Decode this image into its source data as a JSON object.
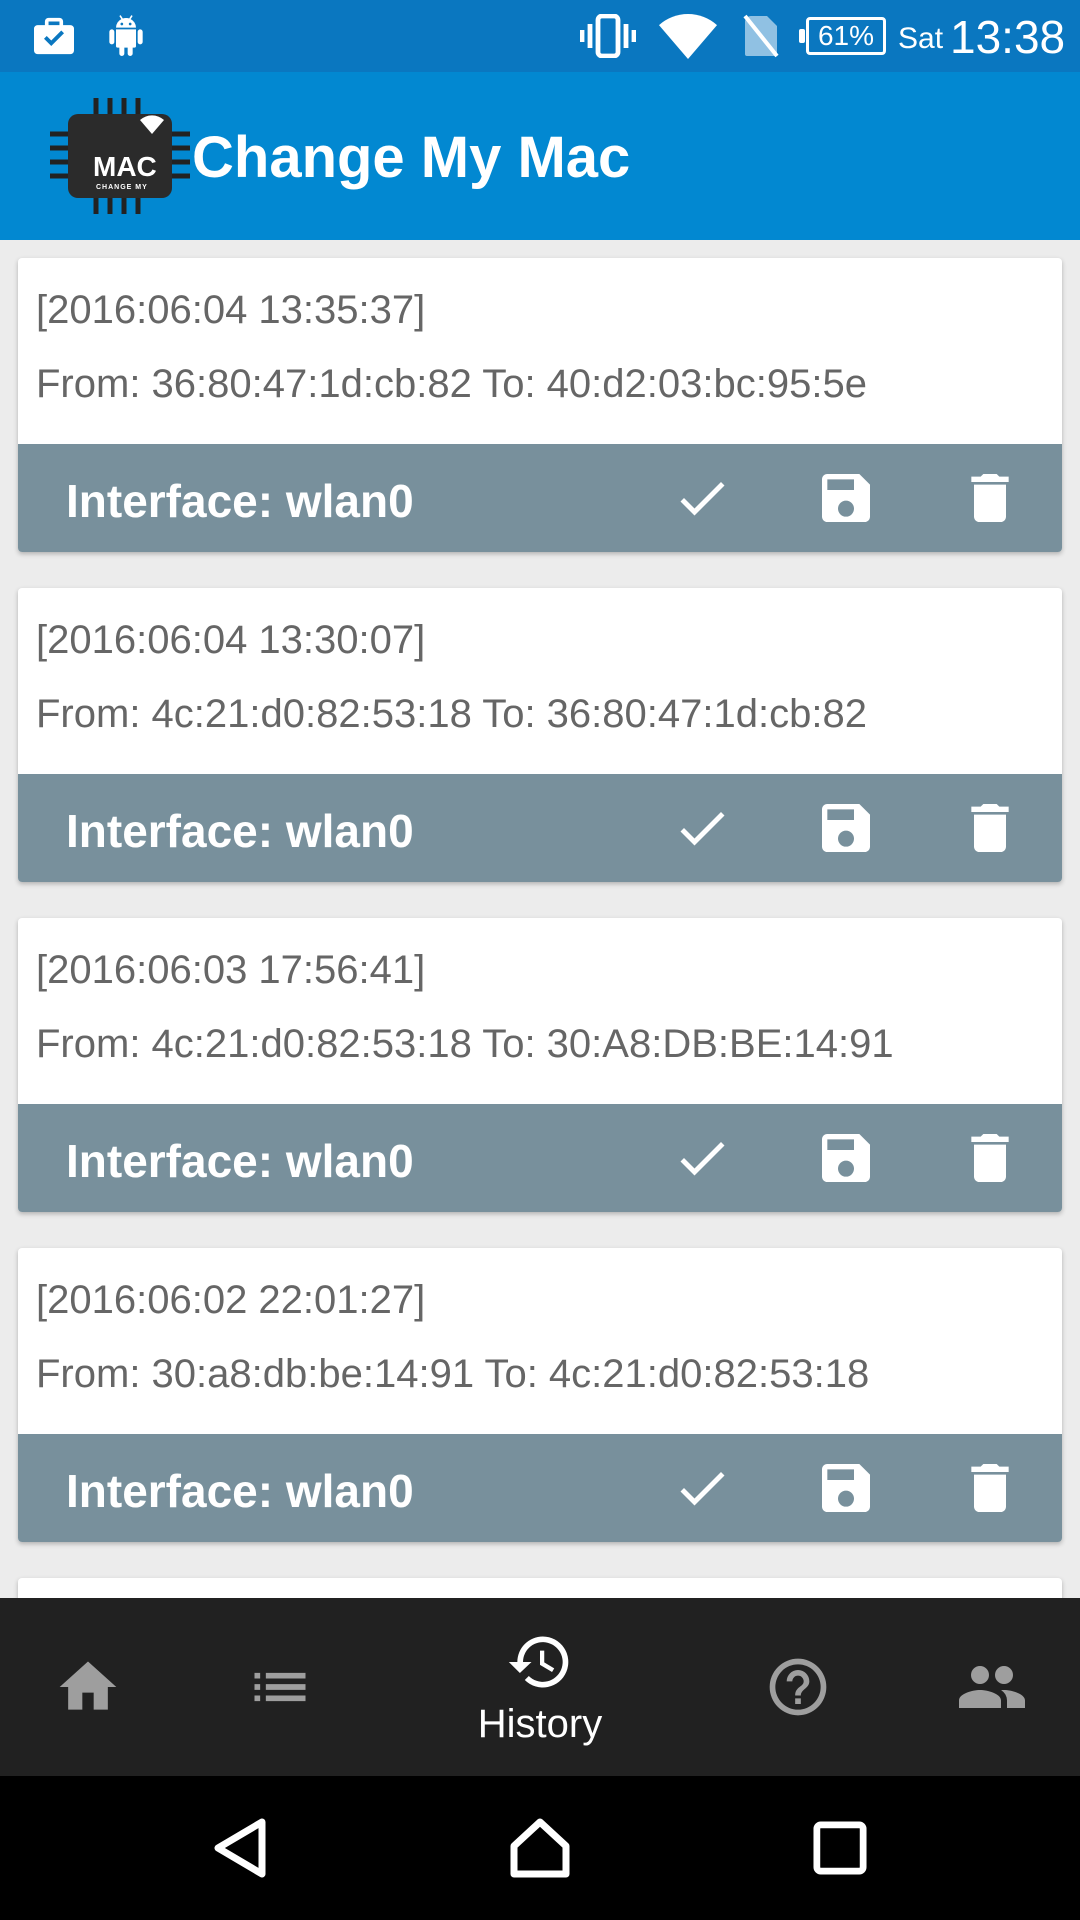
{
  "status_bar": {
    "battery": "61%",
    "day": "Sat",
    "time": "13:38",
    "icons": [
      "briefcase-check-icon",
      "android-icon",
      "vibrate-icon",
      "wifi-icon",
      "no-sim-icon",
      "battery-icon"
    ]
  },
  "app_bar": {
    "title": "Change My Mac",
    "logo_text": "MAC",
    "logo_subtext": "CHANGE MY"
  },
  "history": [
    {
      "timestamp": "[2016:06:04 13:35:37]",
      "change": "From: 36:80:47:1d:cb:82  To: 40:d2:03:bc:95:5e",
      "interface": "Interface: wlan0"
    },
    {
      "timestamp": "[2016:06:04 13:30:07]",
      "change": "From: 4c:21:d0:82:53:18  To: 36:80:47:1d:cb:82",
      "interface": "Interface: wlan0"
    },
    {
      "timestamp": "[2016:06:03 17:56:41]",
      "change": "From: 4c:21:d0:82:53:18  To: 30:A8:DB:BE:14:91",
      "interface": "Interface: wlan0"
    },
    {
      "timestamp": "[2016:06:02 22:01:27]",
      "change": "From: 30:a8:db:be:14:91  To: 4c:21:d0:82:53:18",
      "interface": "Interface: wlan0"
    }
  ],
  "card_actions": [
    "check-icon",
    "save-icon",
    "delete-icon"
  ],
  "bottom_nav": {
    "active": "History",
    "items": [
      "home-icon",
      "list-icon",
      "history-icon",
      "help-icon",
      "people-icon"
    ],
    "history_label": "History"
  },
  "colors": {
    "status_bar": "#0a77c0",
    "app_bar": "#0288d1",
    "card_footer": "#78909c",
    "bottom_nav": "#212121",
    "background": "#ececec"
  }
}
